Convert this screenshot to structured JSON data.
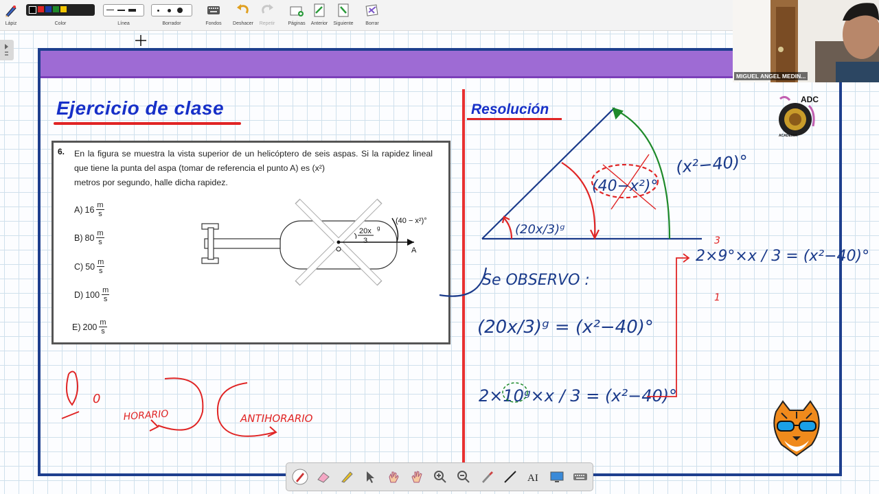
{
  "toolbar": {
    "items": [
      {
        "label": "Lápiz",
        "icon": "pencil-icon"
      },
      {
        "label": "Color",
        "icon": "palette-icon"
      },
      {
        "label": "Línea",
        "icon": "line-width-icon"
      },
      {
        "label": "Borrador",
        "icon": "eraser-icon"
      },
      {
        "label": "Fondos",
        "icon": "keyboard-icon"
      },
      {
        "label": "Deshacer",
        "icon": "undo-icon"
      },
      {
        "label": "Repetir",
        "icon": "redo-icon"
      },
      {
        "label": "Páginas",
        "icon": "add-page-icon"
      },
      {
        "label": "Anterior",
        "icon": "previous-page-icon"
      },
      {
        "label": "Siguiente",
        "icon": "next-page-icon"
      },
      {
        "label": "Borrar",
        "icon": "clear-icon"
      }
    ],
    "colors": [
      "#000000",
      "#e02424",
      "#1a3aa8",
      "#1e8a2a",
      "#f2c500"
    ]
  },
  "board": {
    "title": "Ejercicio de clase",
    "resolution_title": "Resolución"
  },
  "problem": {
    "number": "6.",
    "text": "En la figura se muestra la vista superior de un helicóptero de seis aspas. Si la rapidez lineal que tiene la punta del aspa (tomar de referencia el punto A) es",
    "speed_expr": "(x²)",
    "text_end": "metros por segundo, halle dicha rapidez.",
    "options": [
      {
        "label": "A)",
        "value": "16",
        "unit_num": "m",
        "unit_den": "s"
      },
      {
        "label": "B)",
        "value": "80",
        "unit_num": "m",
        "unit_den": "s"
      },
      {
        "label": "C)",
        "value": "50",
        "unit_num": "m",
        "unit_den": "s"
      },
      {
        "label": "D)",
        "value": "100",
        "unit_num": "m",
        "unit_den": "s"
      },
      {
        "label": "E)",
        "value": "200",
        "unit_num": "m",
        "unit_den": "s"
      }
    ],
    "figure": {
      "angle1": "(40 − x²)°",
      "angle2_num": "20x",
      "angle2_den": "3",
      "angle2_unit": "g",
      "point_center": "O",
      "point_a": "A"
    }
  },
  "handwriting": {
    "zero_note": "0",
    "horario": "HORARIO",
    "antihorario": "ANTIHORARIO",
    "observo": "Se OBSERVO :",
    "angle_big": "(40−x²)°",
    "angle_outer": "(x²−40)°",
    "angle_small": "(20x/3)ᵍ",
    "eq1": "(20x/3)ᵍ = (x²−40)°",
    "eq2": "2×10ᵍ×x / 3 = (x²−40)°",
    "eq3": "2×9°×x / 3 = (x²−40)°",
    "annot_3": "3",
    "annot_1": "1"
  },
  "webcam": {
    "name": "MIGUEL ANGEL MEDIN..."
  },
  "logo": {
    "text": "ADC",
    "subtext": "ACADEMIA"
  },
  "bottom_tools": [
    "pointer-pen-icon",
    "eraser-icon",
    "highlighter-icon",
    "cursor-icon",
    "hand-drag-icon",
    "hand-icon",
    "zoom-in-icon",
    "zoom-out-icon",
    "brush-icon",
    "line-tool-icon",
    "text-tool-icon",
    "screen-icon",
    "keyboard-icon"
  ]
}
